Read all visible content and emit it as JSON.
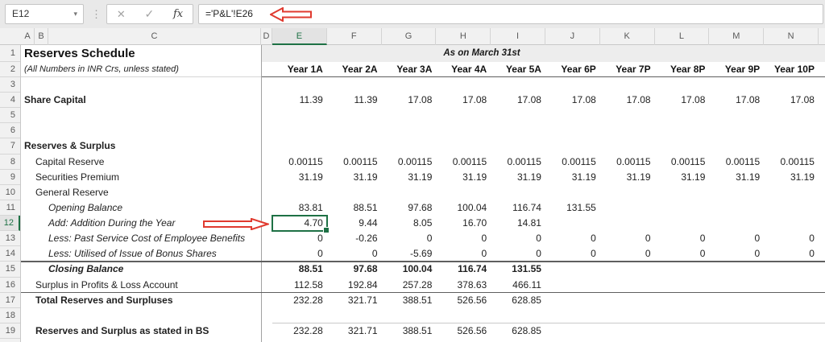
{
  "formula_bar": {
    "name_box": "E12",
    "cancel_icon": "✕",
    "enter_icon": "✓",
    "fx_icon": "fx",
    "formula": "='P&L'!E26"
  },
  "sheet": {
    "column_headers": [
      "A",
      "B",
      "C",
      "D",
      "E",
      "F",
      "G",
      "H",
      "I",
      "J",
      "K",
      "L",
      "M",
      "N"
    ],
    "row_numbers": [
      1,
      2,
      3,
      4,
      5,
      6,
      7,
      8,
      9,
      10,
      11,
      12,
      13,
      14,
      15,
      16,
      17,
      18,
      19
    ],
    "selected_column": "E",
    "selected_row": 12,
    "selected_cell": "E12",
    "title": "Reserves Schedule",
    "subtitle": "(All Numbers in INR Crs, unless stated)",
    "banner": "As on March 31st",
    "year_headers": [
      "Year 1A",
      "Year 2A",
      "Year 3A",
      "Year 4A",
      "Year 5A",
      "Year 6P",
      "Year 7P",
      "Year 8P",
      "Year 9P",
      "Year 10P"
    ],
    "rows": [
      {
        "num": 4,
        "label": "Share Capital",
        "style": "bold0",
        "values": [
          "11.39",
          "11.39",
          "17.08",
          "17.08",
          "17.08",
          "17.08",
          "17.08",
          "17.08",
          "17.08",
          "17.08"
        ]
      },
      {
        "num": 7,
        "label": "Reserves & Surplus",
        "style": "bold0",
        "values": []
      },
      {
        "num": 8,
        "label": "Capital Reserve",
        "style": "reg1",
        "values": [
          "0.00115",
          "0.00115",
          "0.00115",
          "0.00115",
          "0.00115",
          "0.00115",
          "0.00115",
          "0.00115",
          "0.00115",
          "0.00115"
        ]
      },
      {
        "num": 9,
        "label": "Securities Premium",
        "style": "reg1",
        "values": [
          "31.19",
          "31.19",
          "31.19",
          "31.19",
          "31.19",
          "31.19",
          "31.19",
          "31.19",
          "31.19",
          "31.19"
        ]
      },
      {
        "num": 10,
        "label": "General Reserve",
        "style": "reg1",
        "values": []
      },
      {
        "num": 11,
        "label": "Opening Balance",
        "style": "ital2",
        "values": [
          "83.81",
          "88.51",
          "97.68",
          "100.04",
          "116.74",
          "131.55",
          "",
          "",
          "",
          ""
        ]
      },
      {
        "num": 12,
        "label": "Add: Addition During the Year",
        "style": "ital2",
        "values": [
          "4.70",
          "9.44",
          "8.05",
          "16.70",
          "14.81",
          "",
          "",
          "",
          "",
          ""
        ]
      },
      {
        "num": 13,
        "label": "Less: Past Service Cost of Employee Benefits",
        "style": "ital2",
        "values": [
          "0",
          "-0.26",
          "0",
          "0",
          "0",
          "0",
          "0",
          "0",
          "0",
          "0"
        ]
      },
      {
        "num": 14,
        "label": "Less: Utilised of Issue of Bonus Shares",
        "style": "ital2",
        "values": [
          "0",
          "0",
          "-5.69",
          "0",
          "0",
          "0",
          "0",
          "0",
          "0",
          "0"
        ]
      },
      {
        "num": 15,
        "label": "Closing Balance",
        "style": "boldital2",
        "bold_values": true,
        "border_top": true,
        "values": [
          "88.51",
          "97.68",
          "100.04",
          "116.74",
          "131.55",
          "",
          "",
          "",
          "",
          ""
        ]
      },
      {
        "num": 16,
        "label": "Surplus in Profits & Loss Account",
        "style": "reg1",
        "values": [
          "112.58",
          "192.84",
          "257.28",
          "378.63",
          "466.11",
          "",
          "",
          "",
          "",
          ""
        ]
      },
      {
        "num": 17,
        "label": "Total Reserves and Surpluses",
        "style": "bold1",
        "border_top": true,
        "values": [
          "232.28",
          "321.71",
          "388.51",
          "526.56",
          "628.85",
          "",
          "",
          "",
          "",
          ""
        ]
      },
      {
        "num": 19,
        "label": "Reserves and Surplus as stated in BS",
        "style": "bold1",
        "border_top_light": true,
        "values": [
          "232.28",
          "321.71",
          "388.51",
          "526.56",
          "628.85",
          "",
          "",
          "",
          "",
          ""
        ]
      }
    ]
  },
  "colors": {
    "accent_green": "#1E7145",
    "arrow_red": "#E03A2F",
    "band_gray": "#EDEDED",
    "header_gray": "#F1F1F1"
  }
}
